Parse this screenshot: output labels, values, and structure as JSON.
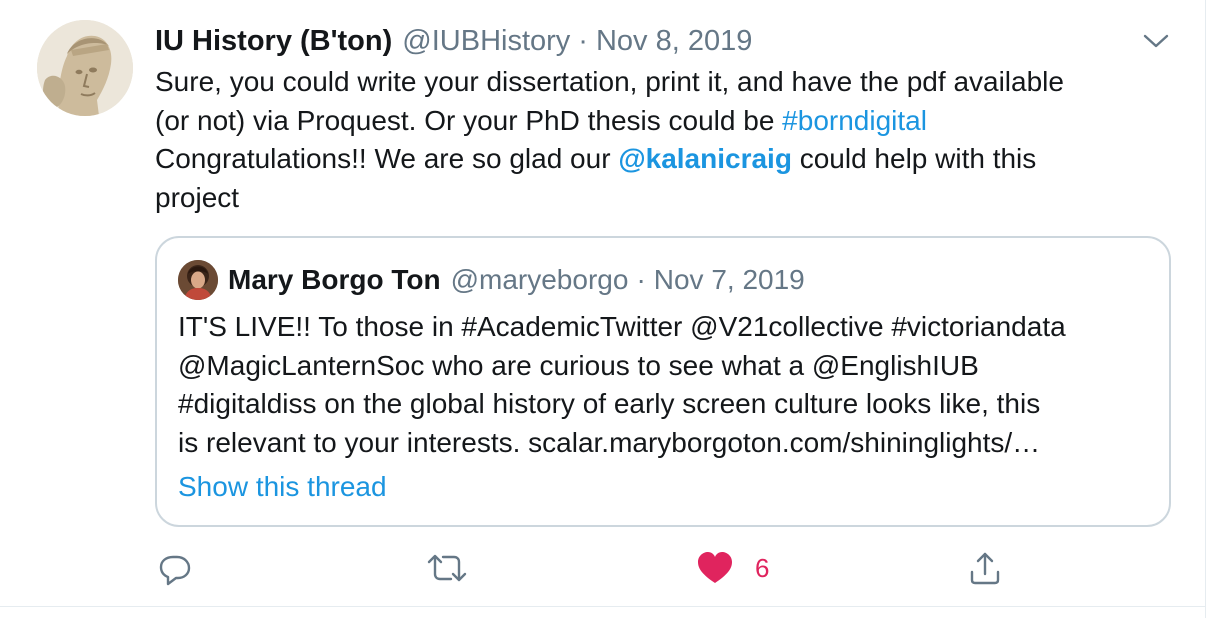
{
  "tweet": {
    "author_name": "IU History (B'ton)",
    "handle": "@IUBHistory",
    "separator": "·",
    "date": "Nov 8, 2019",
    "body": {
      "line1": "Sure, you could write your dissertation, print it, and have the pdf available",
      "line2_text": "(or not) via Proquest. Or your PhD thesis could be ",
      "line2_hashtag": "#borndigital",
      "line3_text_a": "Congratulations!! We are so glad our ",
      "line3_mention": "@kalanicraig",
      "line3_text_b": " could help with this",
      "line4": "project"
    }
  },
  "quoted": {
    "author_name": "Mary Borgo Ton",
    "handle": "@maryeborgo",
    "separator": "·",
    "date": "Nov 7, 2019",
    "body": {
      "line1": "IT'S LIVE!! To those in #AcademicTwitter @V21collective #victoriandata",
      "line2": "@MagicLanternSoc who are curious to see what a @EnglishIUB",
      "line3": "#digitaldiss on the global history of early screen culture looks like, this",
      "line4": "is relevant to your interests.  scalar.maryborgoton.com/shininglights/…"
    },
    "show_thread_label": "Show this thread"
  },
  "actions": {
    "like_count": "6"
  },
  "colors": {
    "link": "#1b95e0",
    "meta": "#657786",
    "like": "#e0245e",
    "border": "#ccd6dd"
  },
  "icons": [
    "caret-down-icon",
    "reply-icon",
    "retweet-icon",
    "heart-icon",
    "share-icon"
  ]
}
